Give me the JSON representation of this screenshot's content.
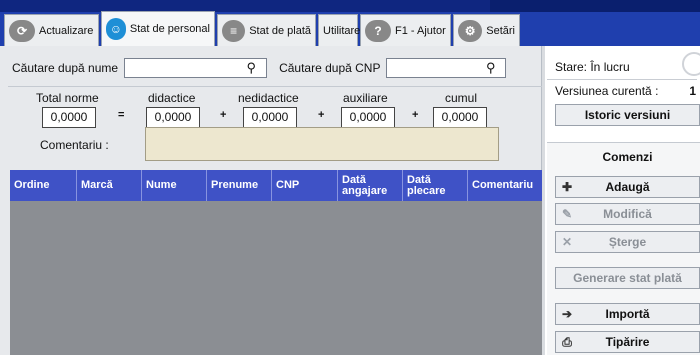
{
  "tabs": [
    {
      "label": "Actualizare",
      "icon": "refresh-icon"
    },
    {
      "label": "Stat de personal",
      "icon": "person-icon"
    },
    {
      "label": "Stat de plată",
      "icon": "list-icon"
    },
    {
      "label": "Utilitare"
    },
    {
      "label": "F1 - Ajutor",
      "icon": "help-icon"
    },
    {
      "label": "Setări",
      "icon": "gear-icon"
    }
  ],
  "search": {
    "name_label": "Căutare după nume",
    "name_value": "",
    "cnp_label": "Căutare după CNP",
    "cnp_value": ""
  },
  "norms": {
    "total": {
      "label": "Total norme",
      "value": "0,0000"
    },
    "didactice": {
      "label": "didactice",
      "value": "0,0000"
    },
    "nedidactice": {
      "label": "nedidactice",
      "value": "0,0000"
    },
    "auxiliare": {
      "label": "auxiliare",
      "value": "0,0000"
    },
    "cumul": {
      "label": "cumul",
      "value": "0,0000"
    },
    "eq": "=",
    "plus": "+",
    "comment_label": "Comentariu :",
    "comment_value": ""
  },
  "grid": {
    "columns": [
      "Ordine",
      "Marcă",
      "Nume",
      "Prenume",
      "CNP",
      "Dată angajare",
      "Dată plecare",
      "Comentariu"
    ]
  },
  "status": {
    "stare": "Stare: În lucru",
    "version_label": "Versiunea curentă :",
    "version_value": "1",
    "history_btn": "Istoric versiuni"
  },
  "commands": {
    "title": "Comenzi",
    "add": "Adaugă",
    "edit": "Modifică",
    "delete": "Șterge",
    "generate": "Generare stat plată",
    "import": "Importă",
    "print": "Tipărire"
  }
}
